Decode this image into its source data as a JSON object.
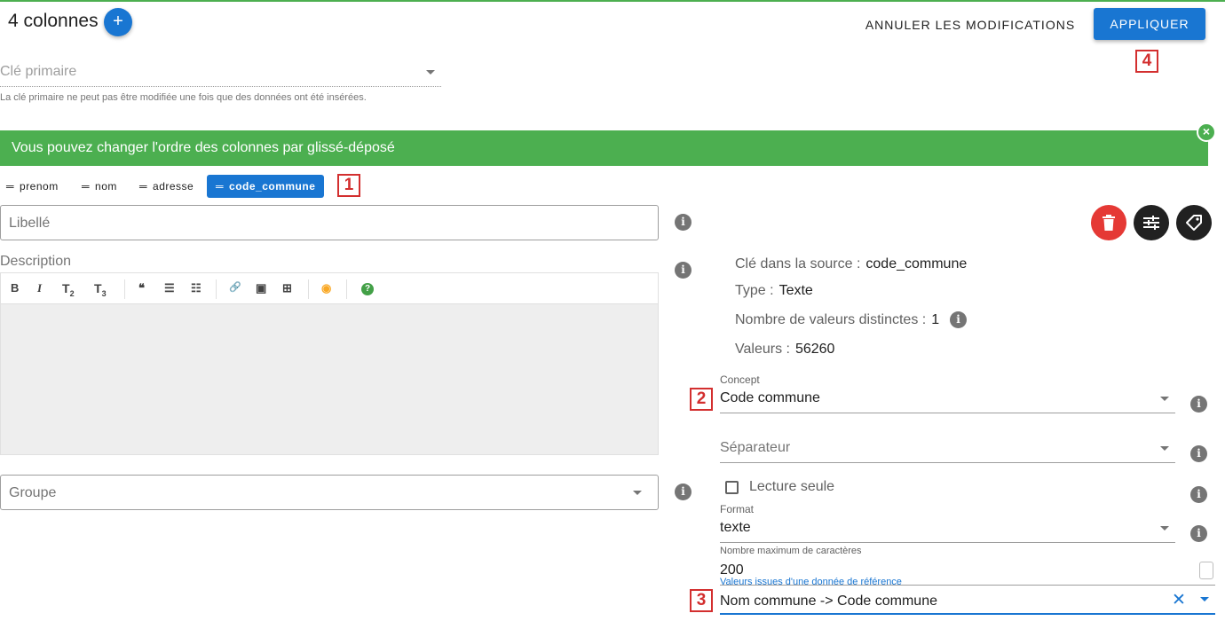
{
  "header": {
    "title": "4 colonnes",
    "add_button": "+",
    "cancel_label": "ANNULER LES MODIFICATIONS",
    "apply_label": "APPLIQUER"
  },
  "markers": {
    "m1": "1",
    "m2": "2",
    "m3": "3",
    "m4": "4"
  },
  "primary_key": {
    "placeholder": "Clé primaire",
    "hint": "La clé primaire ne peut pas être modifiée une fois que des données ont été insérées."
  },
  "banner": {
    "text": "Vous pouvez changer l'ordre des colonnes par glissé-déposé",
    "close": "×"
  },
  "columns": [
    {
      "label": "prenom",
      "active": false
    },
    {
      "label": "nom",
      "active": false
    },
    {
      "label": "adresse",
      "active": false
    },
    {
      "label": "code_commune",
      "active": true
    }
  ],
  "form": {
    "libelle_placeholder": "Libellé",
    "description_label": "Description",
    "groupe_placeholder": "Groupe"
  },
  "editor_toolbar": {
    "bold": "B",
    "italic": "I",
    "t2": "T",
    "t2sub": "2",
    "t3": "T",
    "t3sub": "3",
    "quote": "❝",
    "ul": "☰",
    "ol": "☷",
    "link": "🔗",
    "image": "▣",
    "table": "⊞",
    "preview": "◉",
    "help": "?"
  },
  "details": {
    "source_key_label": "Clé dans la source :",
    "source_key_value": "code_commune",
    "type_label": "Type :",
    "type_value": "Texte",
    "distinct_label": "Nombre de valeurs distinctes :",
    "distinct_value": "1",
    "values_label": "Valeurs :",
    "values_value": "56260"
  },
  "concept": {
    "label": "Concept",
    "value": "Code commune"
  },
  "separator": {
    "placeholder": "Séparateur"
  },
  "readonly": {
    "label": "Lecture seule",
    "checked": false
  },
  "format": {
    "label": "Format",
    "value": "texte"
  },
  "max_chars": {
    "label": "Nombre maximum de caractères",
    "value": "200"
  },
  "reference": {
    "label": "Valeurs issues d'une donnée de référence",
    "value": "Nom commune -> Code commune",
    "clear": "✕"
  },
  "colors": {
    "primary": "#1976d2",
    "success": "#4caf50",
    "danger": "#e53935",
    "dark": "#212121",
    "marker": "#d32f2f"
  },
  "icons": {
    "info": "info-icon",
    "delete": "trash-icon",
    "settings": "sliders-icon",
    "tag": "tag-icon"
  }
}
